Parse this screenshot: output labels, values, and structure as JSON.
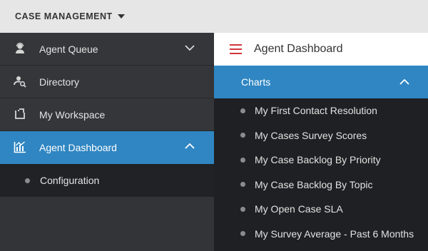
{
  "header": {
    "app_title": "CASE MANAGEMENT"
  },
  "sidebar": {
    "items": [
      {
        "label": "Agent Queue",
        "icon": "agent-icon"
      },
      {
        "label": "Directory",
        "icon": "directory-search-icon"
      },
      {
        "label": "My Workspace",
        "icon": "workspace-icon"
      },
      {
        "label": "Agent Dashboard",
        "icon": "dashboard-chart-icon"
      }
    ],
    "subitems": [
      {
        "label": "Configuration"
      }
    ]
  },
  "panel": {
    "title": "Agent Dashboard",
    "section_title": "Charts",
    "charts": [
      {
        "label": "My First Contact Resolution"
      },
      {
        "label": "My Cases Survey Scores"
      },
      {
        "label": "My Case Backlog By Priority"
      },
      {
        "label": "My Case Backlog By Topic"
      },
      {
        "label": "My Open Case SLA"
      },
      {
        "label": "My Survey Average - Past 6 Months"
      }
    ]
  },
  "colors": {
    "accent": "#2f86c2",
    "menu_red": "#d0363e",
    "sidebar": "#343639",
    "dark": "#1f2023"
  }
}
